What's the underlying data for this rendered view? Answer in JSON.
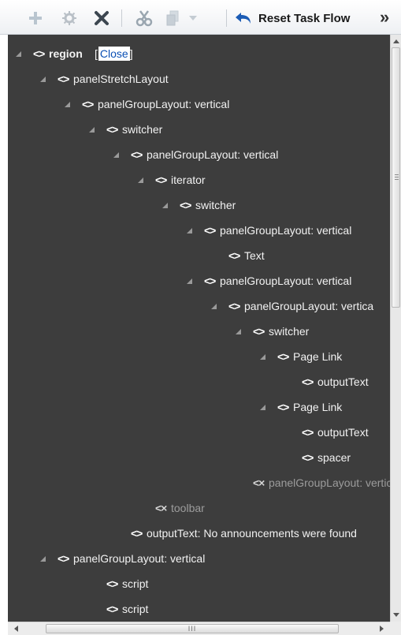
{
  "toolbar": {
    "add_icon": "plus-icon",
    "edit_icon": "gear-edit-icon",
    "delete_icon": "close-x-icon",
    "cut_icon": "scissors-icon",
    "copy_icon": "copy-icon",
    "dropdown_icon": "chevron-down-icon",
    "reset_icon": "undo-arrow-icon",
    "reset_label": "Reset Task Flow",
    "overflow_label": "»"
  },
  "tree": {
    "nodes": [
      {
        "label": "region",
        "link": "Close",
        "bold": true,
        "expandable": true,
        "disabled": false
      },
      {
        "label": "panelStretchLayout",
        "expandable": true,
        "disabled": false
      },
      {
        "label": "panelGroupLayout: vertical",
        "expandable": true,
        "disabled": false
      },
      {
        "label": "switcher",
        "expandable": true,
        "disabled": false
      },
      {
        "label": "panelGroupLayout: vertical",
        "expandable": true,
        "disabled": false
      },
      {
        "label": "iterator",
        "expandable": true,
        "disabled": false
      },
      {
        "label": "switcher",
        "expandable": true,
        "disabled": false
      },
      {
        "label": "panelGroupLayout: vertical",
        "expandable": true,
        "disabled": false
      },
      {
        "label": "Text",
        "expandable": false,
        "disabled": false
      },
      {
        "label": "panelGroupLayout: vertical",
        "expandable": true,
        "disabled": false
      },
      {
        "label": "panelGroupLayout: vertica",
        "expandable": true,
        "disabled": false
      },
      {
        "label": "switcher",
        "expandable": true,
        "disabled": false
      },
      {
        "label": "Page Link",
        "expandable": true,
        "disabled": false
      },
      {
        "label": "outputText",
        "expandable": false,
        "disabled": false
      },
      {
        "label": "Page Link",
        "expandable": true,
        "disabled": false
      },
      {
        "label": "outputText",
        "expandable": false,
        "disabled": false
      },
      {
        "label": "spacer",
        "expandable": false,
        "disabled": false
      },
      {
        "label": "panelGroupLayout: vertica",
        "expandable": false,
        "disabled": true
      },
      {
        "label": "toolbar",
        "expandable": false,
        "disabled": true
      },
      {
        "label": "outputText: No announcements were found",
        "expandable": false,
        "disabled": false
      },
      {
        "label": "panelGroupLayout: vertical",
        "expandable": true,
        "disabled": false
      },
      {
        "label": "script",
        "expandable": false,
        "disabled": false
      },
      {
        "label": "script",
        "expandable": false,
        "disabled": false
      }
    ]
  },
  "scrollbars": {
    "horizontal_thumb_grip": "III"
  },
  "colors": {
    "tree_background": "#3d3d3d",
    "tree_text": "#f2f2f2",
    "disabled_text": "#9c9c9c",
    "accent_blue": "#1c5cb5",
    "link_blue": "#0a4fb4"
  }
}
